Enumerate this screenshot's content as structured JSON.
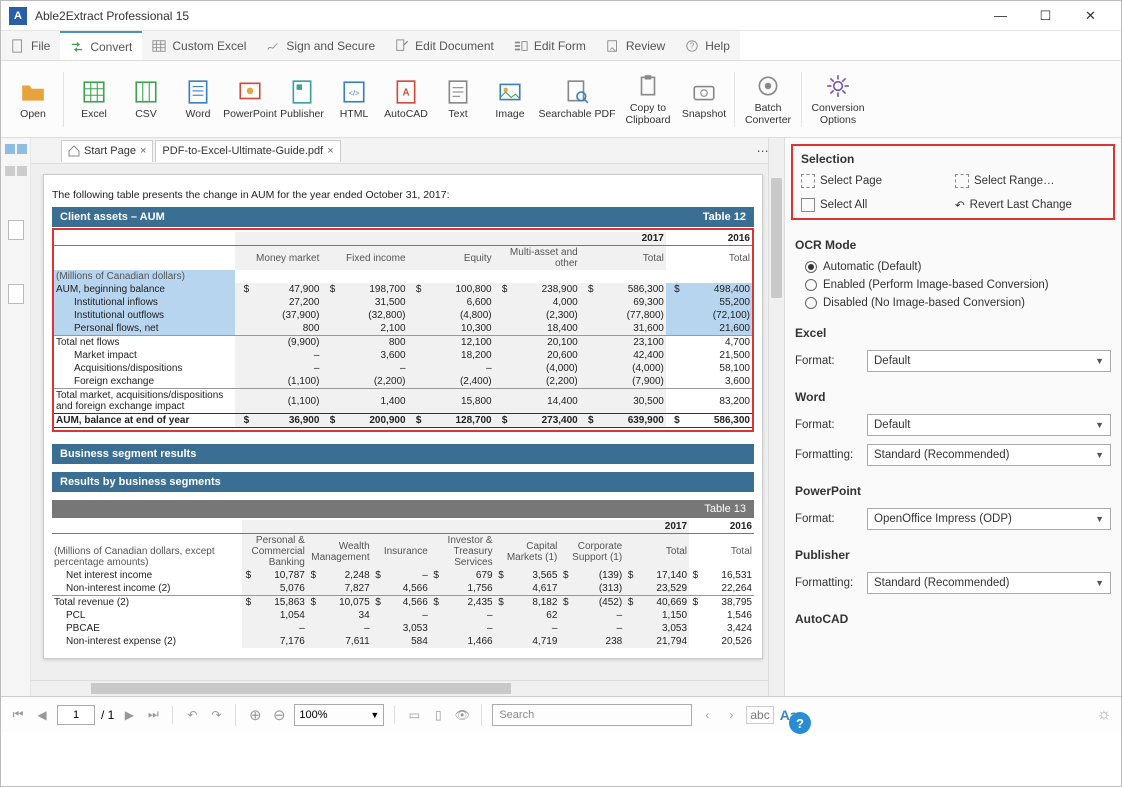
{
  "window": {
    "title": "Able2Extract Professional 15"
  },
  "menu": {
    "file": "File",
    "convert": "Convert",
    "customExcel": "Custom Excel",
    "sign": "Sign and Secure",
    "editDoc": "Edit Document",
    "editForm": "Edit Form",
    "review": "Review",
    "help": "Help"
  },
  "ribbon": {
    "open": "Open",
    "excel": "Excel",
    "csv": "CSV",
    "word": "Word",
    "powerpoint": "PowerPoint",
    "publisher": "Publisher",
    "html": "HTML",
    "autocad": "AutoCAD",
    "text": "Text",
    "image": "Image",
    "searchable": "Searchable PDF",
    "copy": "Copy to Clipboard",
    "snapshot": "Snapshot",
    "batch": "Batch Converter",
    "options": "Conversion Options"
  },
  "tabs": {
    "start": "Start Page",
    "doc": "PDF-to-Excel-Ultimate-Guide.pdf"
  },
  "intro": "The following table presents the change in AUM for the year ended October 31, 2017:",
  "table12": {
    "title": "Client assets – AUM",
    "tag": "Table 12",
    "unit": "(Millions of Canadian dollars)",
    "year1": "2017",
    "year2": "2016",
    "cols": [
      "Money market",
      "Fixed income",
      "Equity",
      "Multi-asset and other",
      "Total",
      "Total"
    ],
    "rows": [
      {
        "l": "AUM, beginning balance",
        "hl": 1,
        "d": [
          "$",
          "47,900",
          "$",
          "198,700",
          "$",
          "100,800",
          "$",
          "238,900",
          "$",
          "586,300",
          "$",
          "498,400"
        ]
      },
      {
        "l": "Institutional inflows",
        "hl": 1,
        "ind": 1,
        "d": [
          "",
          "27,200",
          "",
          "31,500",
          "",
          "6,600",
          "",
          "4,000",
          "",
          "69,300",
          "",
          "55,200"
        ]
      },
      {
        "l": "Institutional outflows",
        "hl": 1,
        "ind": 1,
        "d": [
          "",
          "(37,900)",
          "",
          "(32,800)",
          "",
          "(4,800)",
          "",
          "(2,300)",
          "",
          "(77,800)",
          "",
          "(72,100)"
        ]
      },
      {
        "l": "Personal flows, net",
        "hl": 1,
        "ind": 1,
        "d": [
          "",
          "800",
          "",
          "2,100",
          "",
          "10,300",
          "",
          "18,400",
          "",
          "31,600",
          "",
          "21,600"
        ]
      },
      {
        "l": "Total net flows",
        "bt": 1,
        "d": [
          "",
          "(9,900)",
          "",
          "800",
          "",
          "12,100",
          "",
          "20,100",
          "",
          "23,100",
          "",
          "4,700"
        ]
      },
      {
        "l": "Market impact",
        "ind": 1,
        "d": [
          "",
          "–",
          "",
          "3,600",
          "",
          "18,200",
          "",
          "20,600",
          "",
          "42,400",
          "",
          "21,500"
        ]
      },
      {
        "l": "Acquisitions/dispositions",
        "ind": 1,
        "d": [
          "",
          "–",
          "",
          "–",
          "",
          "–",
          "",
          "(4,000)",
          "",
          "(4,000)",
          "",
          "58,100"
        ]
      },
      {
        "l": "Foreign exchange",
        "ind": 1,
        "d": [
          "",
          "(1,100)",
          "",
          "(2,200)",
          "",
          "(2,400)",
          "",
          "(2,200)",
          "",
          "(7,900)",
          "",
          "3,600"
        ]
      },
      {
        "l": "Total market, acquisitions/dispositions and foreign exchange impact",
        "bt": 1,
        "wrap": 1,
        "d": [
          "",
          "(1,100)",
          "",
          "1,400",
          "",
          "15,800",
          "",
          "14,400",
          "",
          "30,500",
          "",
          "83,200"
        ]
      },
      {
        "l": "AUM, balance at end of year",
        "bold": 1,
        "d": [
          "$",
          "36,900",
          "$",
          "200,900",
          "$",
          "128,700",
          "$",
          "273,400",
          "$",
          "639,900",
          "$",
          "586,300"
        ]
      }
    ]
  },
  "segHeaders": {
    "h1": "Business segment results",
    "h2": "Results by business segments"
  },
  "table13": {
    "tag": "Table 13",
    "year1": "2017",
    "year2": "2016",
    "unit": "(Millions of Canadian dollars, except percentage amounts)",
    "cols": [
      "Personal & Commercial Banking",
      "Wealth Management",
      "Insurance",
      "Investor & Treasury Services",
      "Capital Markets (1)",
      "Corporate Support (1)",
      "Total",
      "Total"
    ],
    "rows": [
      {
        "l": "Net interest income",
        "ind": 1,
        "d": [
          "$",
          "10,787",
          "$",
          "2,248",
          "$",
          "–",
          "$",
          "679",
          "$",
          "3,565",
          "$",
          "(139)",
          "$",
          "17,140",
          "$",
          "16,531"
        ]
      },
      {
        "l": "Non-interest income (2)",
        "ind": 1,
        "d": [
          "",
          "5,076",
          "",
          "7,827",
          "",
          "4,566",
          "",
          "1,756",
          "",
          "4,617",
          "",
          "(313)",
          "",
          "23,529",
          "",
          "22,264"
        ]
      },
      {
        "l": "Total revenue (2)",
        "bt": 1,
        "d": [
          "$",
          "15,863",
          "$",
          "10,075",
          "$",
          "4,566",
          "$",
          "2,435",
          "$",
          "8,182",
          "$",
          "(452)",
          "$",
          "40,669",
          "$",
          "38,795"
        ]
      },
      {
        "l": "PCL",
        "ind": 1,
        "d": [
          "",
          "1,054",
          "",
          "34",
          "",
          "–",
          "",
          "–",
          "",
          "62",
          "",
          "–",
          "",
          "1,150",
          "",
          "1,546"
        ]
      },
      {
        "l": "PBCAE",
        "ind": 1,
        "d": [
          "",
          "–",
          "",
          "–",
          "",
          "3,053",
          "",
          "–",
          "",
          "–",
          "",
          "–",
          "",
          "3,053",
          "",
          "3,424"
        ]
      },
      {
        "l": "Non-interest expense (2)",
        "ind": 1,
        "d": [
          "",
          "7,176",
          "",
          "7,611",
          "",
          "584",
          "",
          "1,466",
          "",
          "4,719",
          "",
          "238",
          "",
          "21,794",
          "",
          "20,526"
        ]
      }
    ]
  },
  "panel": {
    "selection": {
      "hdr": "Selection",
      "page": "Select Page",
      "range": "Select Range…",
      "all": "Select All",
      "revert": "Revert Last Change"
    },
    "ocr": {
      "hdr": "OCR Mode",
      "auto": "Automatic (Default)",
      "en": "Enabled (Perform Image-based Conversion)",
      "dis": "Disabled (No Image-based Conversion)"
    },
    "excel": {
      "hdr": "Excel",
      "format": "Format:",
      "val": "Default"
    },
    "word": {
      "hdr": "Word",
      "format": "Format:",
      "fval": "Default",
      "fmt": "Formatting:",
      "fmtval": "Standard (Recommended)"
    },
    "ppt": {
      "hdr": "PowerPoint",
      "format": "Format:",
      "val": "OpenOffice Impress (ODP)"
    },
    "pub": {
      "hdr": "Publisher",
      "fmt": "Formatting:",
      "val": "Standard (Recommended)"
    },
    "acad": {
      "hdr": "AutoCAD"
    }
  },
  "footer": {
    "page": "1",
    "total": "/ 1",
    "zoom": "100%",
    "search": "Search",
    "abc": "abc",
    "aa": "Aa"
  }
}
